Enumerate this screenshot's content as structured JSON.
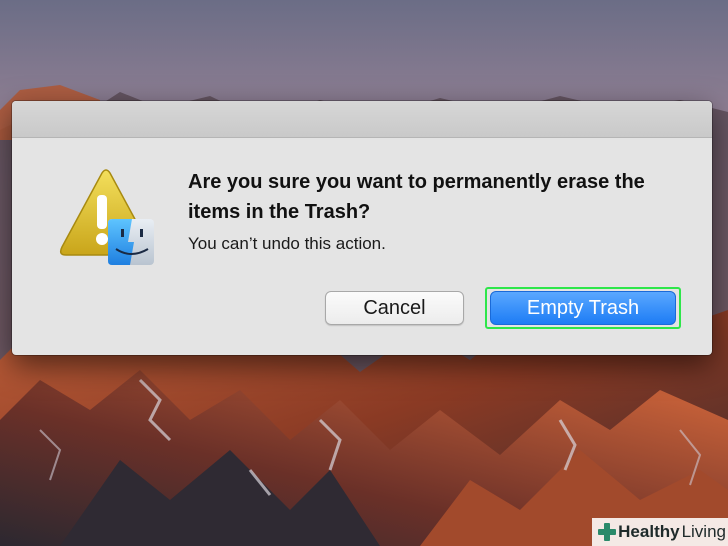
{
  "dialog": {
    "heading": "Are you sure you want to permanently erase the items in the Trash?",
    "message": "You can’t undo this action.",
    "cancel_label": "Cancel",
    "confirm_label": "Empty Trash",
    "icon": "warning-finder-icon"
  },
  "watermark": {
    "brand_bold": "Healthy",
    "brand_light": "Living",
    "icon": "plus-icon"
  },
  "colors": {
    "primary_button": "#1d7cf5",
    "highlight_outline": "#2ee64a",
    "dialog_bg": "#e4e4e4"
  }
}
